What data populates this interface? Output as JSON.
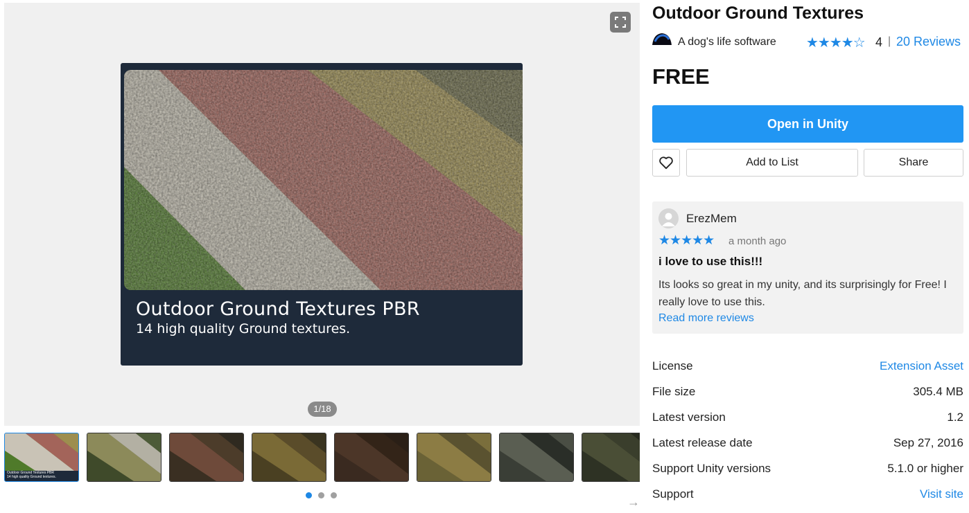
{
  "gallery": {
    "main_caption_title": "Outdoor Ground Textures PBR",
    "main_caption_subtitle": "14 high quality Ground textures.",
    "counter": "1/18",
    "thumb_caption_title": "Outdoor Ground Textures PBR",
    "thumb_caption_subtitle": "14 high quality Ground textures.",
    "thumbnails": [
      {
        "colors": [
          "#4f7a2a",
          "#c9c3b6",
          "#a3645a",
          "#9d8e4f"
        ]
      },
      {
        "colors": [
          "#3f4a2a",
          "#8c8a5a",
          "#b3b0a3",
          "#4d5b38"
        ]
      },
      {
        "colors": [
          "#3a2f22",
          "#6e4a3a",
          "#4c3c2a",
          "#2f2a20"
        ]
      },
      {
        "colors": [
          "#4a4022",
          "#7a6a36",
          "#5a4c2a",
          "#3a3420"
        ]
      },
      {
        "colors": [
          "#3a2a20",
          "#4c3628",
          "#332418",
          "#2a1f16"
        ]
      },
      {
        "colors": [
          "#6a6236",
          "#8c7c44",
          "#5a5230",
          "#7a6e3c"
        ]
      },
      {
        "colors": [
          "#3a3e36",
          "#5a5e52",
          "#2a2e28",
          "#4a4e44"
        ]
      },
      {
        "colors": [
          "#2e3224",
          "#4a4e36",
          "#3a3e2c",
          "#26291e"
        ]
      }
    ],
    "dots_count": 3,
    "next_arrow": "→"
  },
  "product": {
    "title": "Outdoor Ground Textures",
    "publisher": "A dog's life software",
    "stars": "★★★★☆",
    "rating": "4",
    "separator": "|",
    "reviews_link": "20 Reviews",
    "price": "FREE",
    "open_button": "Open in Unity",
    "add_to_list_button": "Add to List",
    "share_button": "Share"
  },
  "review": {
    "user": "ErezMem",
    "stars": "★★★★★",
    "time": "a month ago",
    "title": "i love to use this!!!",
    "body": "Its looks so great in my unity, and its surprisingly for Free! I really love to use this.",
    "read_more": "Read more reviews"
  },
  "info": [
    {
      "label": "License",
      "value": "Extension Asset",
      "link": true
    },
    {
      "label": "File size",
      "value": "305.4 MB",
      "link": false
    },
    {
      "label": "Latest version",
      "value": "1.2",
      "link": false
    },
    {
      "label": "Latest release date",
      "value": "Sep 27, 2016",
      "link": false
    },
    {
      "label": "Support Unity versions",
      "value": "5.1.0 or higher",
      "link": false
    },
    {
      "label": "Support",
      "value": "Visit site",
      "link": true
    }
  ],
  "colors": {
    "accent": "#2196f3",
    "link": "#1e88e5",
    "banner_bg": "#1e2a3a"
  },
  "icons": {
    "fullscreen": "fullscreen-icon",
    "heart": "heart-icon",
    "next": "arrow-right-icon"
  }
}
